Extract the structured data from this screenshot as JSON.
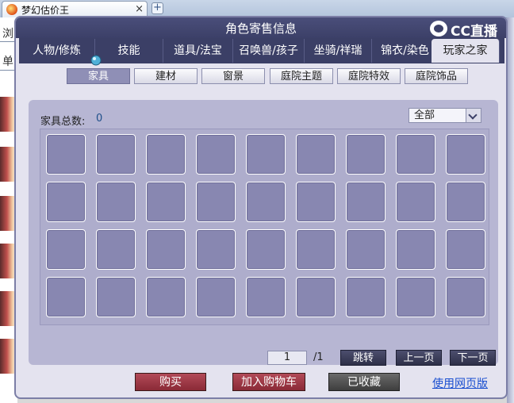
{
  "browser": {
    "tab_title": "梦幻估价王",
    "tab_close": "×",
    "new_tab": "+"
  },
  "background_page": {
    "text1": "浏",
    "text2": "单"
  },
  "dialog": {
    "title": "角色寄售信息",
    "logo_text": "CC直播",
    "main_tabs": [
      {
        "label": "人物/修炼"
      },
      {
        "label": "技能"
      },
      {
        "label": "道具/法宝"
      },
      {
        "label": "召唤兽/孩子"
      },
      {
        "label": "坐骑/祥瑞"
      },
      {
        "label": "锦衣/染色"
      },
      {
        "label": "玩家之家"
      }
    ],
    "active_main_tab": "玩家之家",
    "sub_tabs": [
      {
        "label": "家具"
      },
      {
        "label": "建材"
      },
      {
        "label": "窗景"
      },
      {
        "label": "庭院主题"
      },
      {
        "label": "庭院特效"
      },
      {
        "label": "庭院饰品"
      }
    ],
    "active_sub_tab": "家具",
    "panel": {
      "count_label": "家具总数:",
      "count_value": "0",
      "filter_value": "全部"
    },
    "pager": {
      "current_page": "1",
      "total": "/1",
      "jump_label": "跳转",
      "prev_label": "上一页",
      "next_label": "下一页"
    },
    "actions": {
      "buy_label": "购买",
      "cart_label": "加入购物车",
      "fav_label": "已收藏",
      "web_link": "使用网页版"
    }
  },
  "colors": {
    "title_bar": "#3c4068",
    "panel": "#b7b6d3",
    "slot": "#8887b1",
    "buy_button": "#8a2a36",
    "link": "#1a4fd0"
  },
  "icons": {
    "tab_favicon": "game-favicon-icon",
    "close": "close-icon",
    "new_tab": "plus-icon",
    "dropdown": "chevron-down-icon",
    "cursor": "hand-cursor-icon",
    "logo": "cc-logo-icon"
  }
}
